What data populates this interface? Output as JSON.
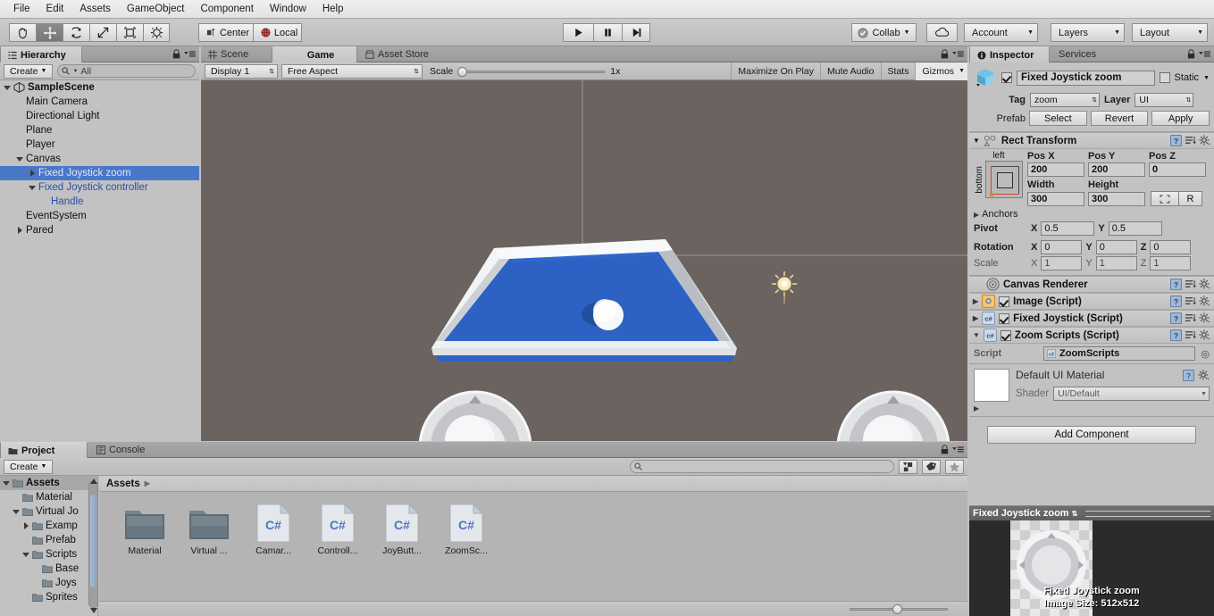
{
  "menubar": {
    "items": [
      "File",
      "Edit",
      "Assets",
      "GameObject",
      "Component",
      "Window",
      "Help"
    ]
  },
  "toolbar": {
    "tools": [
      "hand-tool",
      "move-tool",
      "rotate-tool",
      "scale-tool",
      "rect-tool",
      "transform-tool"
    ],
    "pivot_mode": "Center",
    "pivot_rotation": "Local",
    "play": "play-button",
    "pause": "pause-button",
    "step": "step-button",
    "collab": "Collab",
    "cloud": "cloud-button",
    "account": "Account",
    "layers": "Layers",
    "layout": "Layout"
  },
  "hierarchy": {
    "tab": "Hierarchy",
    "create_label": "Create",
    "search_value": "All",
    "items": [
      {
        "label": "SampleScene",
        "depth": 0,
        "arrow": "down",
        "bold": true,
        "icon": "scene-icon"
      },
      {
        "label": "Main Camera",
        "depth": 1,
        "arrow": "none"
      },
      {
        "label": "Directional Light",
        "depth": 1,
        "arrow": "none"
      },
      {
        "label": "Plane",
        "depth": 1,
        "arrow": "none"
      },
      {
        "label": "Player",
        "depth": 1,
        "arrow": "none"
      },
      {
        "label": "Canvas",
        "depth": 1,
        "arrow": "down"
      },
      {
        "label": "Fixed Joystick zoom",
        "depth": 2,
        "arrow": "right",
        "selected": true,
        "prefab": true
      },
      {
        "label": "Fixed Joystick controller",
        "depth": 2,
        "arrow": "down",
        "prefab": true
      },
      {
        "label": "Handle",
        "depth": 3,
        "arrow": "none",
        "prefab": true
      },
      {
        "label": "EventSystem",
        "depth": 1,
        "arrow": "none"
      },
      {
        "label": "Pared",
        "depth": 1,
        "arrow": "right"
      }
    ]
  },
  "gameview": {
    "tabs": [
      {
        "label": "Scene",
        "icon": "grid-icon",
        "active": false
      },
      {
        "label": "Game",
        "icon": "gamepad-icon",
        "active": true
      },
      {
        "label": "Asset Store",
        "icon": "store-icon",
        "active": false
      }
    ],
    "display": "Display 1",
    "aspect": "Free Aspect",
    "scale_label": "Scale",
    "scale_value": "1x",
    "maximize": "Maximize On Play",
    "mute": "Mute Audio",
    "stats": "Stats",
    "gizmos": "Gizmos",
    "background_color": "#6b635f",
    "floor_color": "#2d62c4",
    "wall_color": "#f2f3f5"
  },
  "inspector": {
    "tabs": [
      {
        "label": "Inspector",
        "active": true
      },
      {
        "label": "Services",
        "active": false
      }
    ],
    "object_name": "Fixed Joystick zoom",
    "object_enabled": true,
    "static_label": "Static",
    "tag_label": "Tag",
    "tag_value": "zoom",
    "layer_label": "Layer",
    "layer_value": "UI",
    "prefab_label": "Prefab",
    "prefab_buttons": [
      "Select",
      "Revert",
      "Apply"
    ],
    "rect_transform": {
      "title": "Rect Transform",
      "anchor_h": "left",
      "anchor_v": "bottom",
      "pos_labels": [
        "Pos X",
        "Pos Y",
        "Pos Z"
      ],
      "pos_values": [
        "200",
        "200",
        "0"
      ],
      "size_labels": [
        "Width",
        "Height"
      ],
      "size_values": [
        "300",
        "300"
      ],
      "blueprint_btn": "blueprint-mode-icon",
      "raw_btn": "R",
      "anchors_label": "Anchors",
      "pivot_label": "Pivot",
      "pivot_x": "0.5",
      "pivot_y": "0.5",
      "rotation_label": "Rotation",
      "rotation_values": [
        "0",
        "0",
        "0"
      ],
      "scale_label": "Scale",
      "scale_values": [
        "1",
        "1",
        "1"
      ]
    },
    "components": [
      {
        "name": "Canvas Renderer",
        "icon": "canvas-renderer-icon",
        "has_checkbox": false,
        "expanded": false
      },
      {
        "name": "Image (Script)",
        "icon": "image-icon",
        "has_checkbox": true,
        "checked": true,
        "expanded": false
      },
      {
        "name": "Fixed Joystick (Script)",
        "icon": "csharp-icon",
        "has_checkbox": true,
        "checked": true,
        "expanded": false
      },
      {
        "name": "Zoom Scripts (Script)",
        "icon": "csharp-icon",
        "has_checkbox": true,
        "checked": true,
        "expanded": true
      }
    ],
    "script_row_label": "Script",
    "script_row_value": "ZoomScripts",
    "material_name": "Default UI Material",
    "shader_label": "Shader",
    "shader_value": "UI/Default",
    "add_component": "Add Component",
    "preview_title": "Fixed Joystick zoom",
    "preview_caption_1": "Fixed Joystick zoom",
    "preview_caption_2": "Image Size: 512x512"
  },
  "project": {
    "tabs": [
      {
        "label": "Project",
        "icon": "folder-icon",
        "active": true
      },
      {
        "label": "Console",
        "icon": "console-icon",
        "active": false
      }
    ],
    "create_label": "Create",
    "search_placeholder": "",
    "breadcrumb": "Assets",
    "tree": [
      {
        "label": "Assets",
        "depth": 0,
        "arrow": "down",
        "bold": true
      },
      {
        "label": "Material",
        "depth": 1,
        "arrow": "none"
      },
      {
        "label": "Virtual Jo",
        "depth": 1,
        "arrow": "down"
      },
      {
        "label": "Examp",
        "depth": 2,
        "arrow": "right"
      },
      {
        "label": "Prefab",
        "depth": 2,
        "arrow": "none"
      },
      {
        "label": "Scripts",
        "depth": 2,
        "arrow": "down"
      },
      {
        "label": "Base",
        "depth": 3,
        "arrow": "none"
      },
      {
        "label": "Joys",
        "depth": 3,
        "arrow": "none"
      },
      {
        "label": "Sprites",
        "depth": 2,
        "arrow": "none"
      }
    ],
    "assets": [
      {
        "label": "Material",
        "type": "folder"
      },
      {
        "label": "Virtual ...",
        "type": "folder"
      },
      {
        "label": "Camar...",
        "type": "csharp"
      },
      {
        "label": "Controll...",
        "type": "csharp"
      },
      {
        "label": "JoyButt...",
        "type": "csharp"
      },
      {
        "label": "ZoomSc...",
        "type": "csharp"
      }
    ]
  }
}
